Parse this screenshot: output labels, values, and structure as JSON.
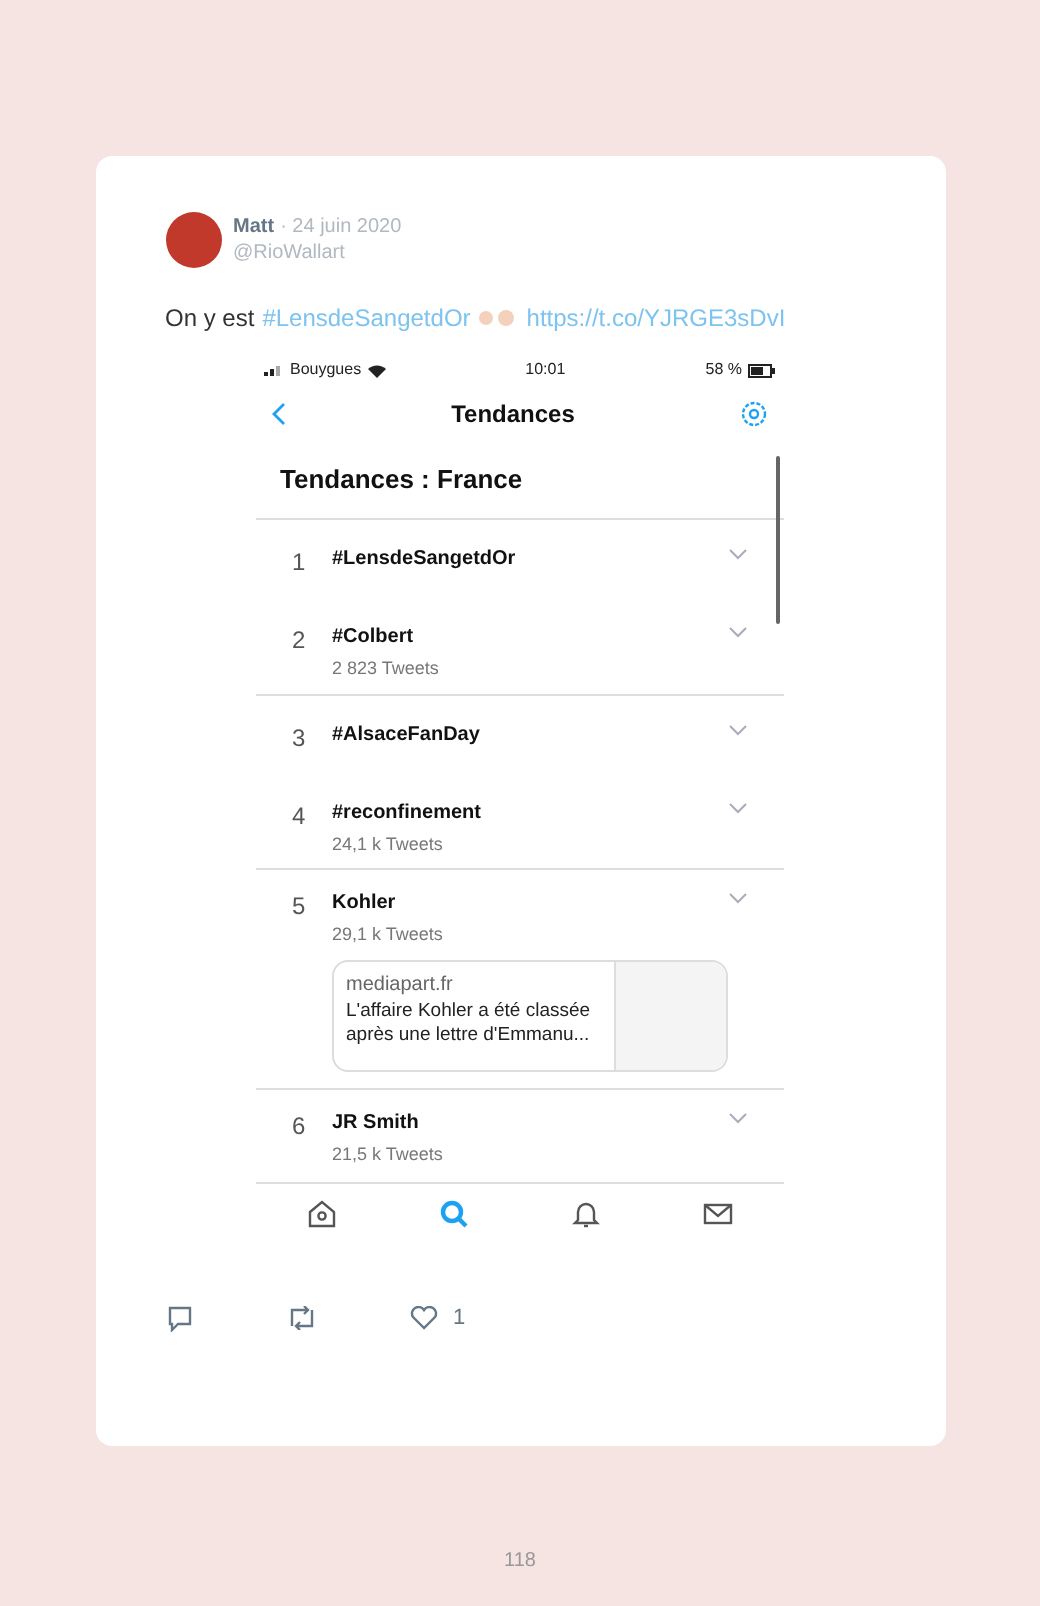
{
  "tweet": {
    "author": "Matt",
    "date": "· 24 juin 2020",
    "handle": "@RioWallart",
    "text": "On y est",
    "hashtag": "#LensdeSangetdOr",
    "link": "https://t.co/YJRGE3sDvI"
  },
  "phone": {
    "status_bar": {
      "carrier": "Bouygues",
      "time": "10:01",
      "battery": "58 %"
    },
    "title": "Tendances",
    "section": "Tendances : France",
    "trends": [
      {
        "rank": "1",
        "name": "#LensdeSangetdOr"
      },
      {
        "rank": "2",
        "name": "#Colbert",
        "count": "2 823 Tweets"
      },
      {
        "rank": "3",
        "name": "#AlsaceFanDay"
      },
      {
        "rank": "4",
        "name": "#reconfinement",
        "count": "24,1 k Tweets"
      },
      {
        "rank": "5",
        "name": "Kohler",
        "count": "29,1 k Tweets",
        "preview": {
          "site": "mediapart.fr",
          "title": "L'affaire Kohler a été classée après une lettre d'Emmanu..."
        }
      },
      {
        "rank": "6",
        "name": "JR Smith",
        "count": "21,5 k Tweets"
      }
    ],
    "tabs": [
      {
        "kind": "home",
        "selected": false
      },
      {
        "kind": "search",
        "selected": true
      },
      {
        "kind": "bell",
        "selected": false
      },
      {
        "kind": "mail",
        "selected": false
      }
    ]
  },
  "actions": {
    "likes": "1"
  },
  "page_number": "118"
}
